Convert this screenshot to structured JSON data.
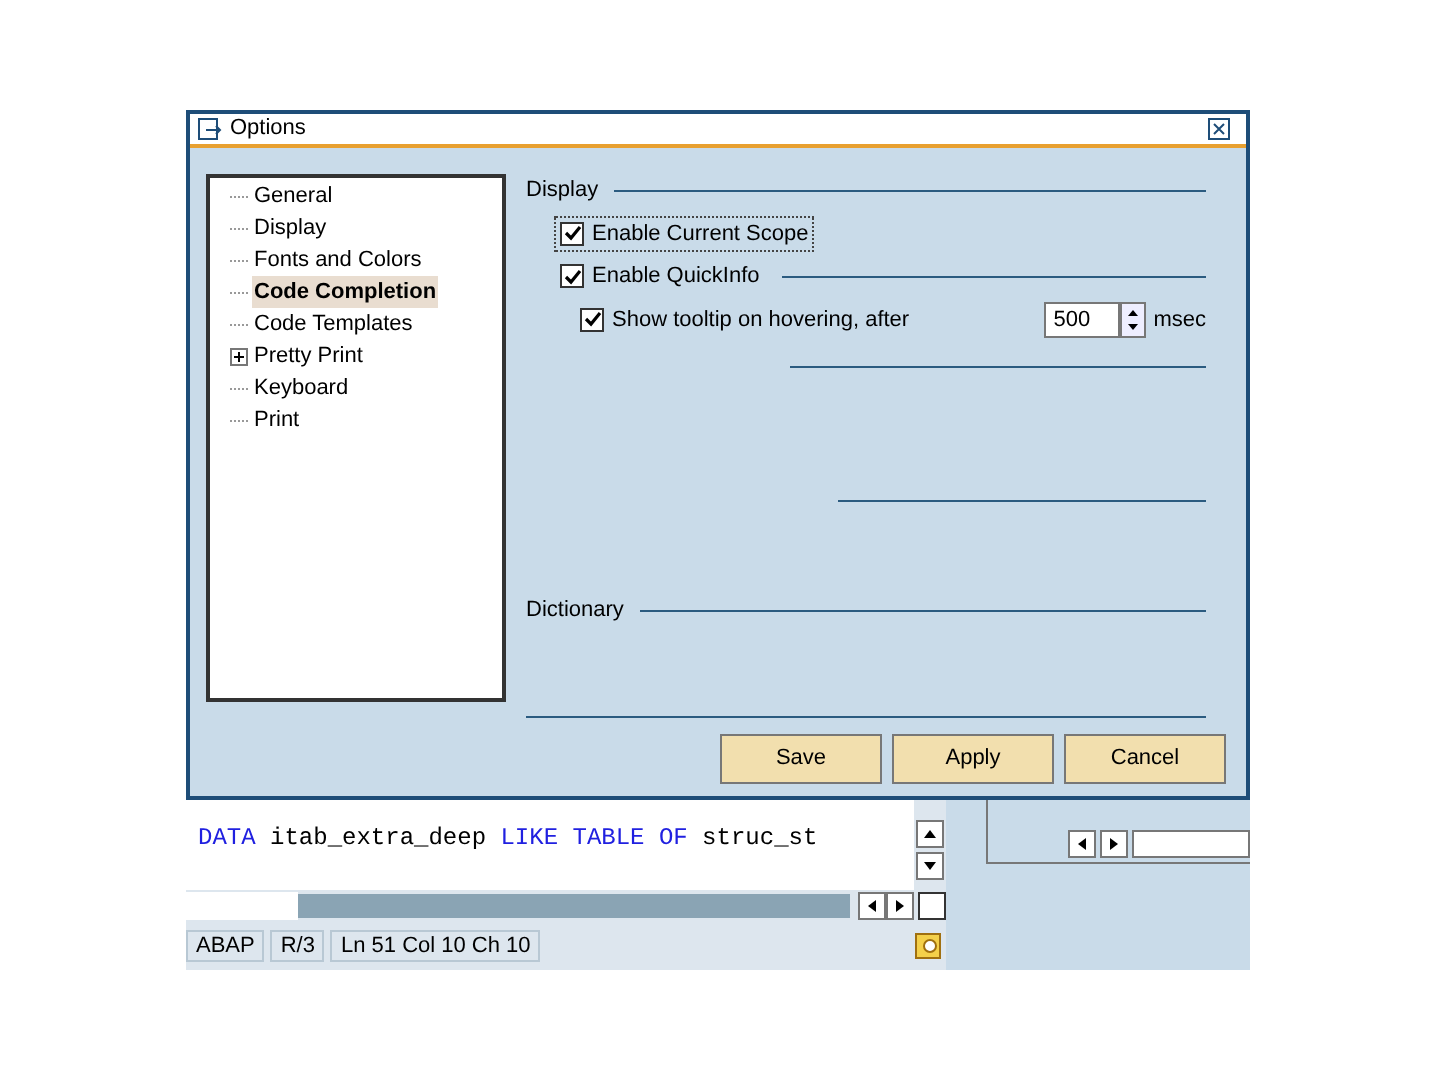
{
  "window": {
    "title": "Options"
  },
  "tree": [
    {
      "label": "General",
      "selected": false
    },
    {
      "label": "Display",
      "selected": false
    },
    {
      "label": "Fonts and Colors",
      "selected": false
    },
    {
      "label": "Code Completion",
      "selected": true
    },
    {
      "label": "Code Templates",
      "selected": false
    },
    {
      "label": "Pretty Print",
      "selected": false,
      "expanded": false,
      "has_children": true
    },
    {
      "label": "Keyboard",
      "selected": false
    },
    {
      "label": "Print",
      "selected": false
    }
  ],
  "display_group": {
    "title": "Display",
    "options": [
      {
        "label": "Enable Current Scope",
        "checked": true,
        "focused": true
      },
      {
        "label": "Enable QuickInfo",
        "checked": true,
        "focused": false,
        "children": [
          {
            "label": "Show tooltip on hovering, after",
            "checked": true,
            "focused": false,
            "value": "500",
            "unit": "msec"
          }
        ]
      }
    ]
  },
  "dictionary_group": {
    "title": "Dictionary"
  },
  "buttons": [
    "Save",
    "Apply",
    "Cancel"
  ],
  "code_line": [
    {
      "kind": "keyword",
      "text": "DATA"
    },
    {
      "kind": "text",
      "text": " itab_extra_deep "
    },
    {
      "kind": "keyword",
      "text": "LIKE TABLE OF"
    },
    {
      "kind": "text",
      "text": " struc_st"
    }
  ],
  "status_bar": [
    "ABAP",
    "R/3",
    "Ln 51 Col 10 Ch 10"
  ]
}
